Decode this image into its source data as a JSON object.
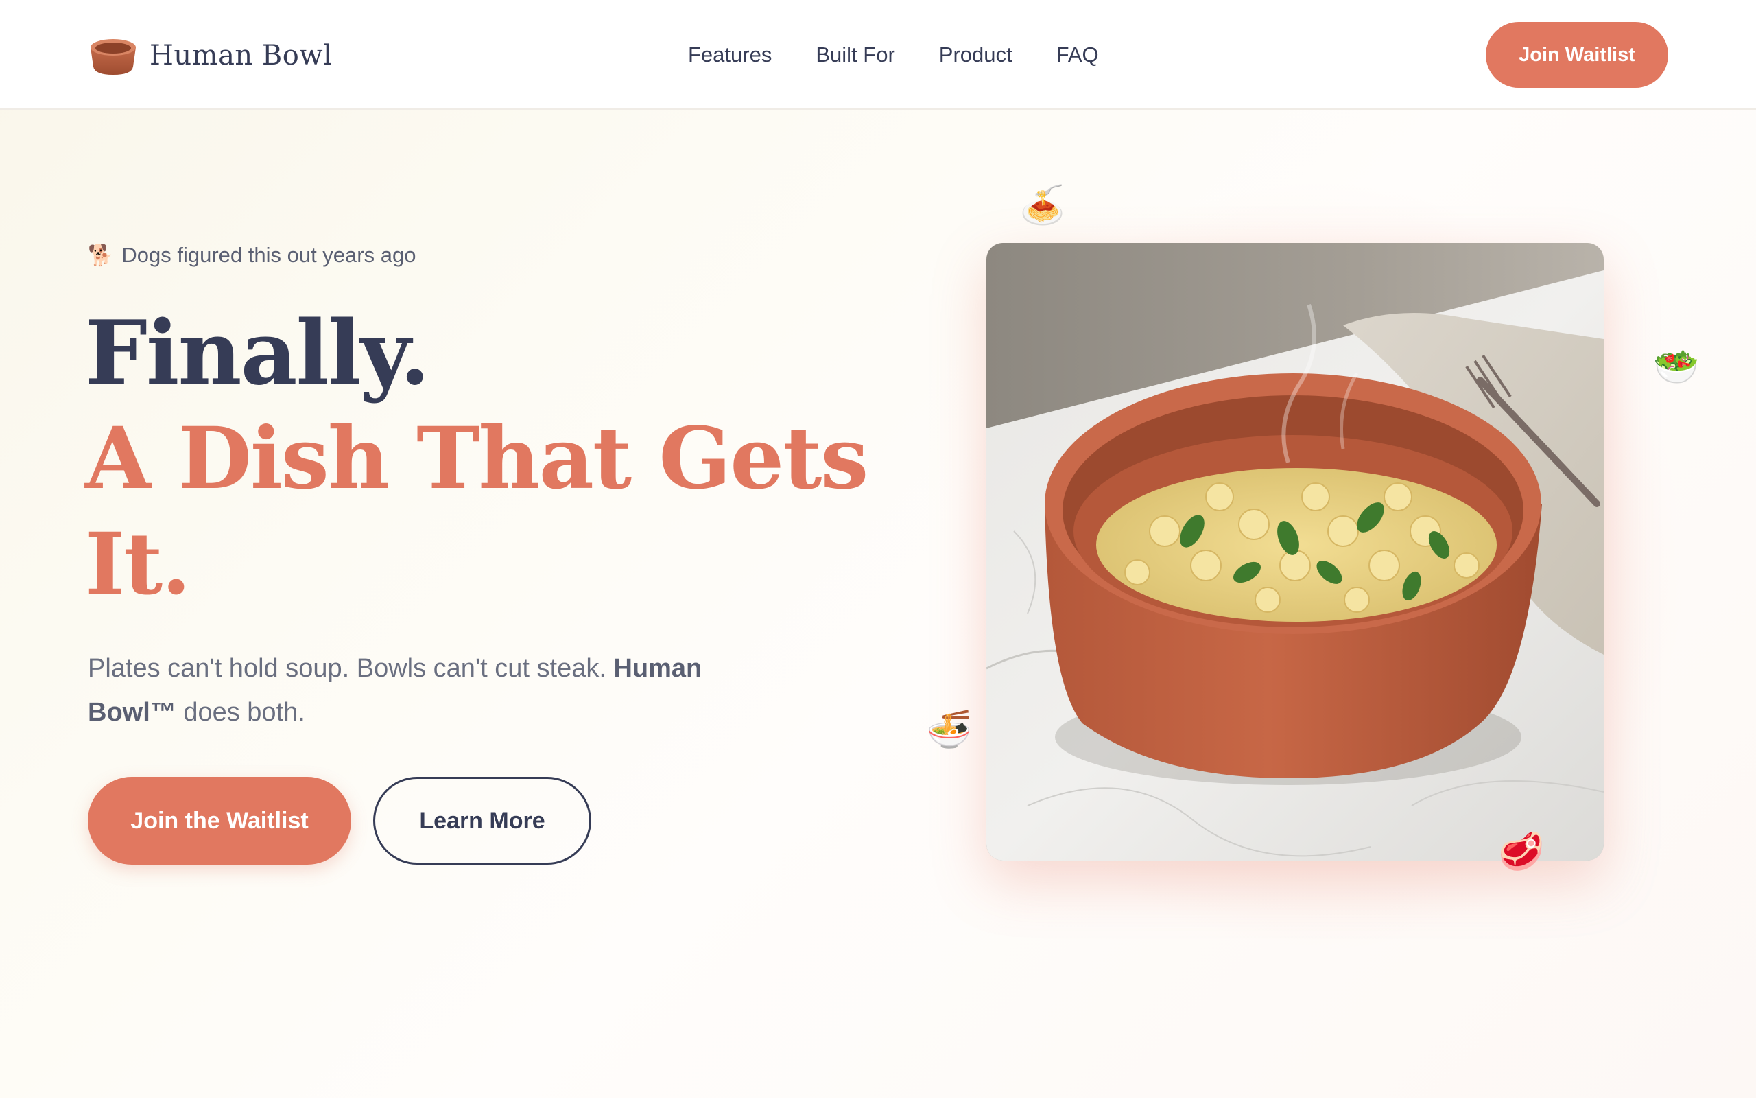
{
  "nav": {
    "brand": "Human Bowl",
    "links": [
      "Features",
      "Built For",
      "Product",
      "FAQ"
    ],
    "cta_label": "Join Waitlist"
  },
  "hero": {
    "eyebrow_icon": "🐕",
    "eyebrow": "Dogs figured this out years ago",
    "headline_line1": "Finally.",
    "headline_line2": "A Dish That Gets",
    "headline_line3": "It.",
    "subtitle_text": "Plates can't hold soup. Bowls can't cut steak. ",
    "subtitle_bold": "Human Bowl™",
    "subtitle_end": " does both.",
    "primary_cta": "Join the Waitlist",
    "secondary_cta": "Learn More"
  },
  "floating_icons": {
    "spaghetti": "🍝",
    "salad": "🥗",
    "soup": "🍜",
    "steak": "🥩"
  },
  "colors": {
    "accent": "#e17860",
    "navy": "#363c56",
    "muted_text": "#6a6f80"
  }
}
